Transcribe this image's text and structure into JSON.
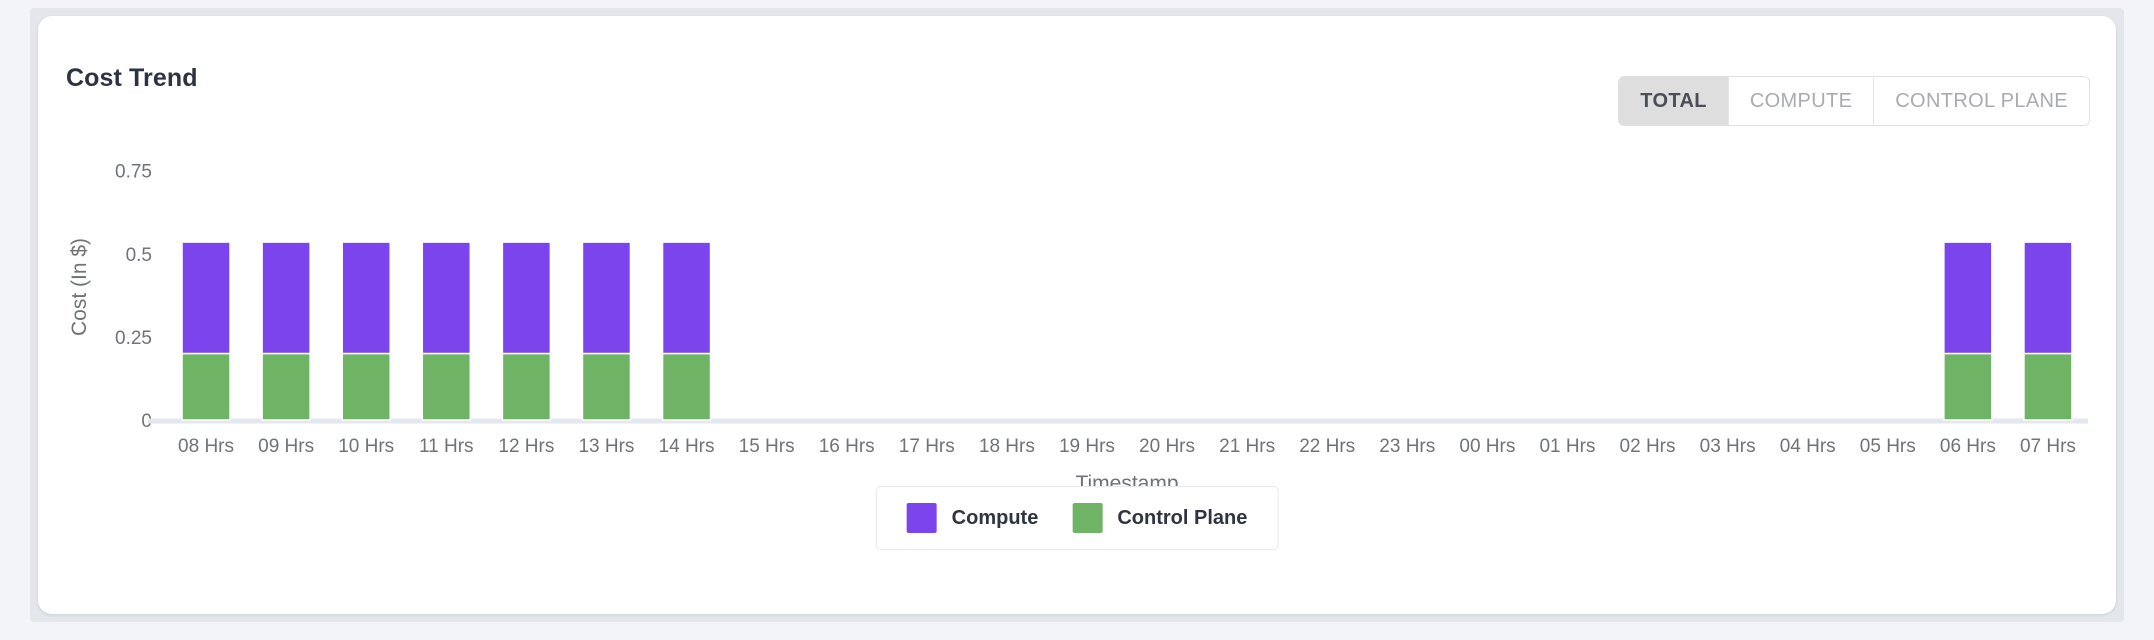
{
  "card": {
    "title": "Cost Trend"
  },
  "toggles": [
    {
      "label": "TOTAL",
      "active": true
    },
    {
      "label": "COMPUTE",
      "active": false
    },
    {
      "label": "CONTROL PLANE",
      "active": false
    }
  ],
  "colors": {
    "compute": "#7c44ec",
    "control_plane": "#6fb464",
    "axis": "#e4e7ef",
    "tick_text": "#6f7377",
    "card_background": "#ffffff",
    "page_background": "#f2f4f7",
    "toggle_active_background": "#dedede"
  },
  "chart_data": {
    "type": "bar",
    "title": "Cost Trend",
    "subtitle": "",
    "stacked": true,
    "xlabel": "Timestamp",
    "ylabel": "Cost (In $)",
    "ylim": [
      0,
      0.8
    ],
    "yticks": [
      0,
      0.25,
      0.5,
      0.75
    ],
    "ytick_labels": [
      "0",
      "0.25",
      "0.5",
      "0.75"
    ],
    "grid": false,
    "legend_position": "bottom",
    "categories": [
      "08 Hrs",
      "09 Hrs",
      "10 Hrs",
      "11 Hrs",
      "12 Hrs",
      "13 Hrs",
      "14 Hrs",
      "15 Hrs",
      "16 Hrs",
      "17 Hrs",
      "18 Hrs",
      "19 Hrs",
      "20 Hrs",
      "21 Hrs",
      "22 Hrs",
      "23 Hrs",
      "00 Hrs",
      "01 Hrs",
      "02 Hrs",
      "03 Hrs",
      "04 Hrs",
      "05 Hrs",
      "06 Hrs",
      "07 Hrs"
    ],
    "series": [
      {
        "name": "Control Plane",
        "color": "#6fb464",
        "values": [
          0.2,
          0.2,
          0.2,
          0.2,
          0.2,
          0.2,
          0.2,
          0,
          0,
          0,
          0,
          0,
          0,
          0,
          0,
          0,
          0,
          0,
          0,
          0,
          0,
          0,
          0.2,
          0.2
        ]
      },
      {
        "name": "Compute",
        "color": "#7c44ec",
        "values": [
          0.335,
          0.335,
          0.335,
          0.335,
          0.335,
          0.335,
          0.335,
          0,
          0,
          0,
          0,
          0,
          0,
          0,
          0,
          0,
          0,
          0,
          0,
          0,
          0,
          0,
          0.335,
          0.335
        ]
      }
    ],
    "totals": [
      0.535,
      0.535,
      0.535,
      0.535,
      0.535,
      0.535,
      0.535,
      0,
      0,
      0,
      0,
      0,
      0,
      0,
      0,
      0,
      0,
      0,
      0,
      0,
      0,
      0,
      0.535,
      0.535
    ]
  },
  "legend": [
    {
      "label": "Compute",
      "color": "#7c44ec"
    },
    {
      "label": "Control Plane",
      "color": "#6fb464"
    }
  ]
}
